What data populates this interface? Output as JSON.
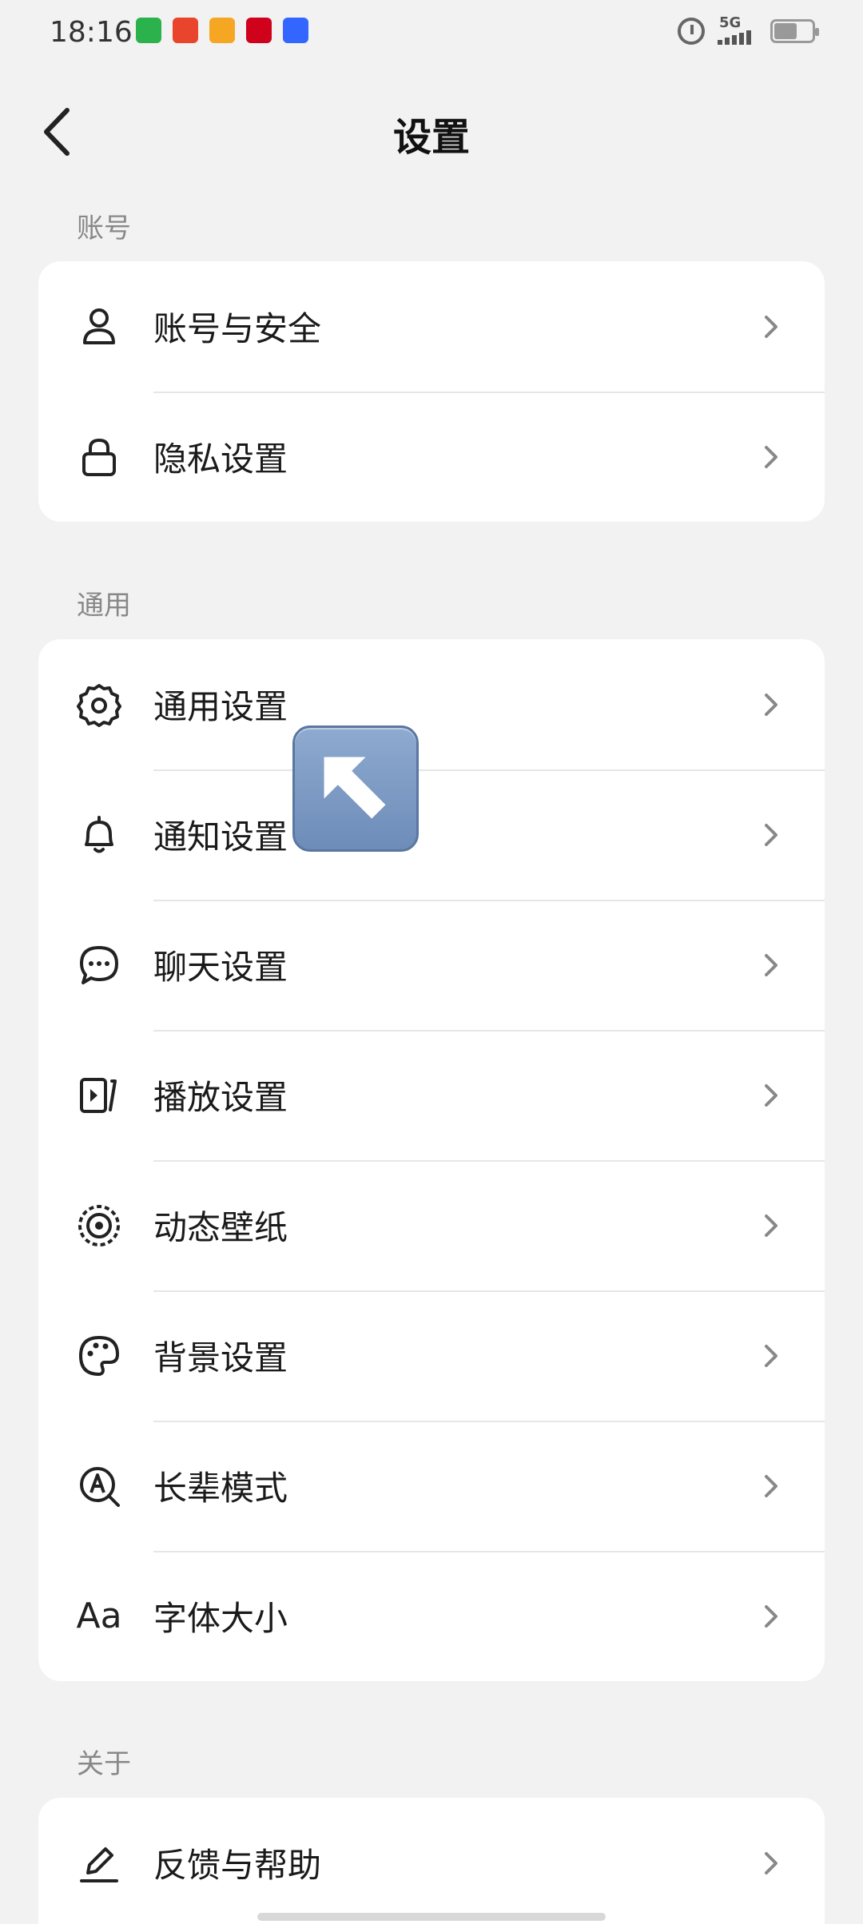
{
  "status_bar": {
    "time": "18:16",
    "network": "5G",
    "battery_level": 0.6,
    "notification_icons": [
      {
        "name": "video-app-icon",
        "color": "#2bb24c"
      },
      {
        "name": "shopping-app-icon",
        "color": "#e8452c"
      },
      {
        "name": "58-app-icon",
        "color": "#f5a623"
      },
      {
        "name": "jd-app-icon",
        "color": "#d0021b"
      },
      {
        "name": "baidu-app-icon",
        "color": "#3366ff"
      }
    ]
  },
  "header": {
    "title": "设置"
  },
  "sections": {
    "account": {
      "label": "账号",
      "items": [
        {
          "label": "账号与安全",
          "icon": "user-icon"
        },
        {
          "label": "隐私设置",
          "icon": "lock-icon"
        }
      ]
    },
    "general": {
      "label": "通用",
      "items": [
        {
          "label": "通用设置",
          "icon": "gear-icon"
        },
        {
          "label": "通知设置",
          "icon": "bell-icon"
        },
        {
          "label": "聊天设置",
          "icon": "chat-bubble-icon"
        },
        {
          "label": "播放设置",
          "icon": "play-icon"
        },
        {
          "label": "动态壁纸",
          "icon": "live-wallpaper-icon"
        },
        {
          "label": "背景设置",
          "icon": "palette-icon"
        },
        {
          "label": "长辈模式",
          "icon": "elder-mode-icon"
        },
        {
          "label": "字体大小",
          "icon": "font-size-icon",
          "icon_text": "Aa"
        }
      ]
    },
    "about": {
      "label": "关于",
      "items": [
        {
          "label": "反馈与帮助",
          "icon": "pen-icon"
        }
      ]
    }
  }
}
